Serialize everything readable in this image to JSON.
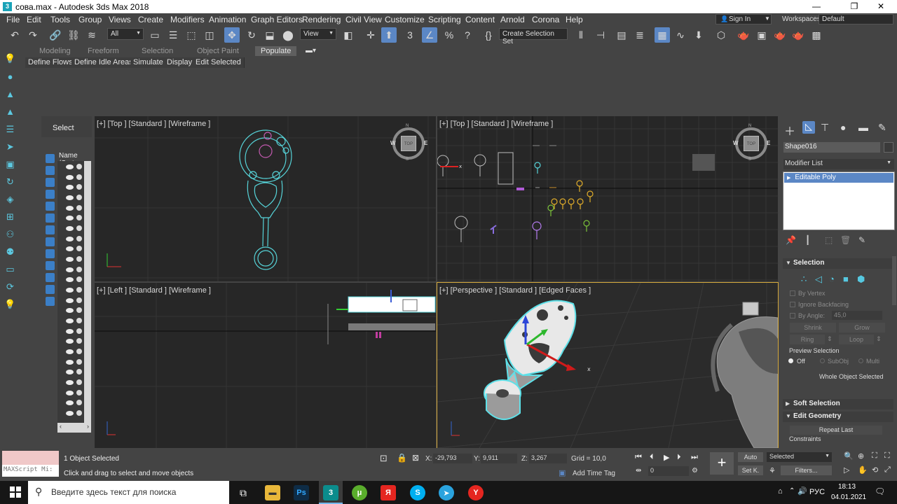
{
  "window": {
    "title": "сова.max - Autodesk 3ds Max 2018",
    "buttons": [
      "—",
      "❐",
      "✕"
    ]
  },
  "menu": {
    "items": [
      "File",
      "Edit",
      "Tools",
      "Group",
      "Views",
      "Create",
      "Modifiers",
      "Animation",
      "Graph Editors",
      "Rendering",
      "Civil View",
      "Customize",
      "Scripting",
      "Content",
      "Arnold",
      "Corona",
      "Help"
    ],
    "sign_in": "Sign In",
    "workspaces_label": "Workspaces:",
    "workspace": "Default"
  },
  "toolbar": {
    "filter": "All",
    "view": "View",
    "selection_set": "Create Selection Set"
  },
  "ribbon": {
    "tabs": [
      "Modeling",
      "Freeform",
      "Selection",
      "Object Paint",
      "Populate"
    ],
    "active_tab": "Populate",
    "subtabs": [
      "Define Flows",
      "Define Idle Areas",
      "Simulate",
      "Display",
      "Edit Selected"
    ]
  },
  "explorer": {
    "select_label": "Select",
    "column": "Name (Sorte"
  },
  "viewports": {
    "top_left": "[+] [Top ] [Standard ] [Wireframe ]",
    "top_right": "[+] [Top ] [Standard ] [Wireframe ]",
    "bottom_left": "[+] [Left ] [Standard ] [Wireframe ]",
    "bottom_right": "[+] [Perspective ] [Standard ] [Edged Faces ]",
    "viewcube": "TOP",
    "compass": {
      "n": "N",
      "s": "S",
      "w": "W",
      "e": "E"
    }
  },
  "command_panel": {
    "object_name": "Shape016",
    "modifier_list": "Modifier List",
    "stack_item": "Editable Poly",
    "selection": {
      "title": "Selection",
      "by_vertex": "By Vertex",
      "ignore_backfacing": "Ignore Backfacing",
      "by_angle": "By Angle:",
      "angle_value": "45,0",
      "shrink": "Shrink",
      "grow": "Grow",
      "ring": "Ring",
      "loop": "Loop",
      "preview_selection": "Preview Selection",
      "off": "Off",
      "subobj": "SubObj",
      "multi": "Multi",
      "whole_object": "Whole Object Selected"
    },
    "soft_selection": "Soft Selection",
    "edit_geometry": "Edit Geometry",
    "repeat_last": "Repeat Last",
    "constraints": "Constraints"
  },
  "status": {
    "maxscript": "MAXScript Mi:",
    "objects_selected": "1 Object Selected",
    "prompt": "Click and drag to select and move objects",
    "x_label": "X:",
    "x_value": "-29,793",
    "y_label": "Y:",
    "y_value": "9,911",
    "z_label": "Z:",
    "z_value": "3,267",
    "grid": "Grid = 10,0",
    "add_time_tag": "Add Time Tag",
    "frame": "0",
    "auto": "Auto",
    "set_k": "Set K.",
    "selected": "Selected",
    "filters": "Filters..."
  },
  "taskbar": {
    "search": "Введите здесь текст для поиска",
    "language": "РУС",
    "time": "18:13",
    "date": "04.01.2021"
  }
}
